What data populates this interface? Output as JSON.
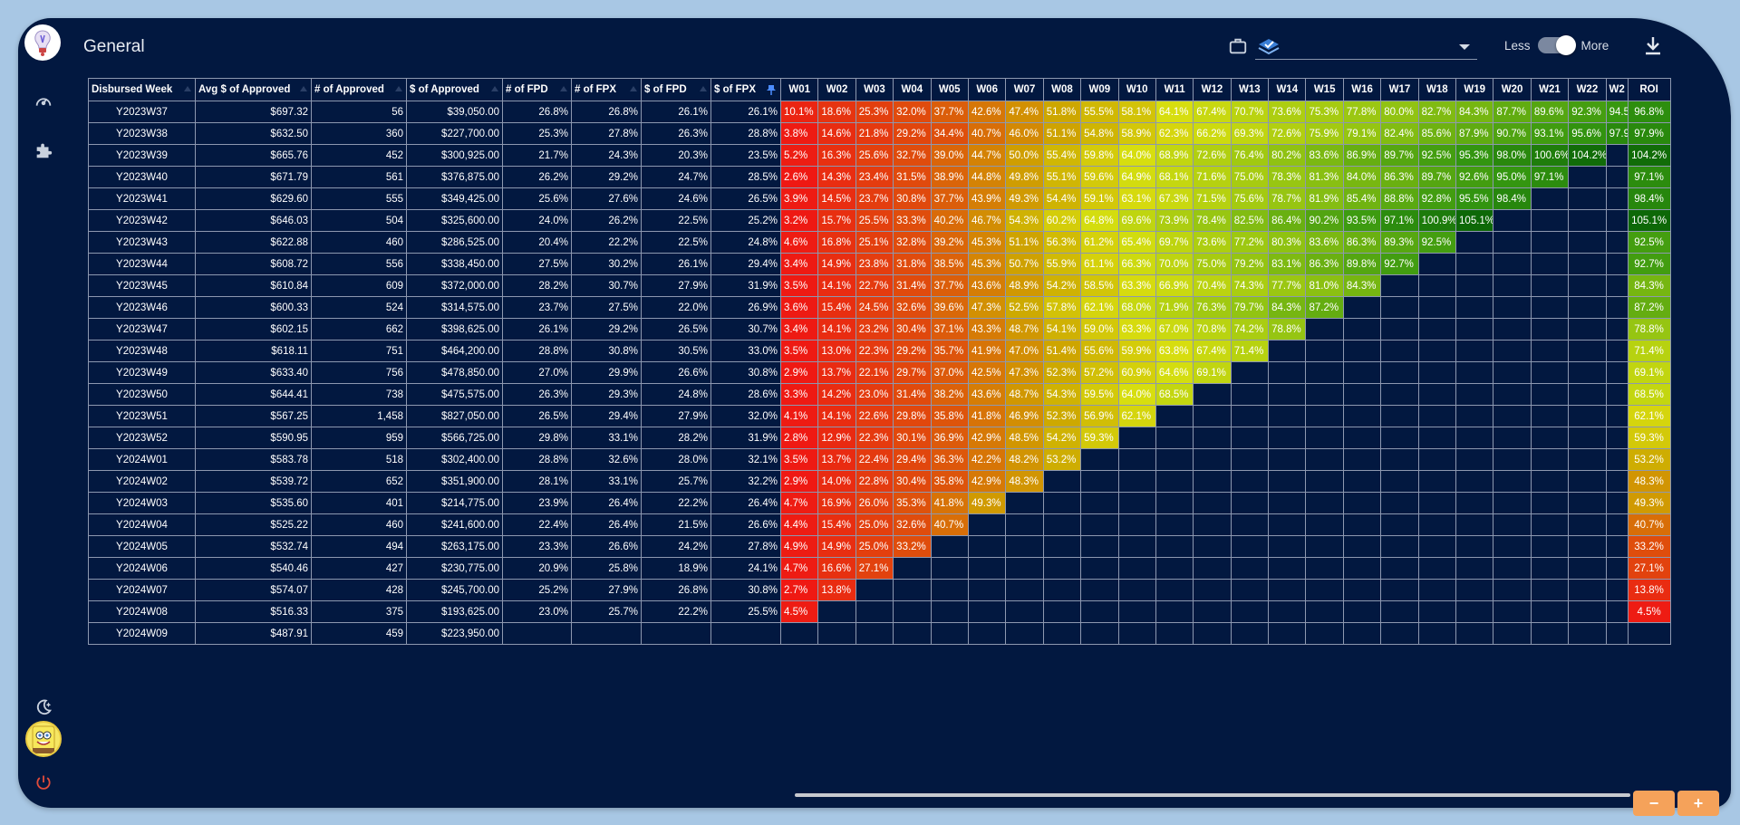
{
  "app": {
    "title": "General",
    "toggle": {
      "less_label": "Less",
      "more_label": "More",
      "state": "More"
    },
    "zoom": {
      "minus_label": "−",
      "plus_label": "+"
    }
  },
  "table": {
    "headers": [
      "Disbursed Week",
      "Avg $ of Approved",
      "# of Approved",
      "$ of Approved",
      "# of FPD",
      "# of FPX",
      "$ of FPD",
      "$ of FPX"
    ],
    "week_headers": [
      "W01",
      "W02",
      "W03",
      "W04",
      "W05",
      "W06",
      "W07",
      "W08",
      "W09",
      "W10",
      "W11",
      "W12",
      "W13",
      "W14",
      "W15",
      "W16",
      "W17",
      "W18",
      "W19",
      "W20",
      "W21",
      "W22",
      "W2"
    ],
    "roi_header": "ROI",
    "rows": [
      {
        "week": "Y2023W37",
        "avg": "$697.32",
        "n": "56",
        "amt": "$39,050.00",
        "nfpd": "26.8%",
        "nfpx": "26.8%",
        "dfpd": "26.1%",
        "dfpx": "26.1%",
        "cells": [
          "10.1%",
          "18.6%",
          "25.3%",
          "32.0%",
          "37.7%",
          "42.6%",
          "47.4%",
          "51.8%",
          "55.5%",
          "58.1%",
          "64.1%",
          "67.4%",
          "70.7%",
          "73.6%",
          "75.3%",
          "77.8%",
          "80.0%",
          "82.7%",
          "84.3%",
          "87.7%",
          "89.6%",
          "92.3%",
          "94.5"
        ],
        "roi": "96.8%"
      },
      {
        "week": "Y2023W38",
        "avg": "$632.50",
        "n": "360",
        "amt": "$227,700.00",
        "nfpd": "25.3%",
        "nfpx": "27.8%",
        "dfpd": "26.3%",
        "dfpx": "28.8%",
        "cells": [
          "3.8%",
          "14.6%",
          "21.8%",
          "29.2%",
          "34.4%",
          "40.7%",
          "46.0%",
          "51.1%",
          "54.8%",
          "58.9%",
          "62.3%",
          "66.2%",
          "69.3%",
          "72.6%",
          "75.9%",
          "79.1%",
          "82.4%",
          "85.6%",
          "87.9%",
          "90.7%",
          "93.1%",
          "95.6%",
          "97.9"
        ],
        "roi": "97.9%"
      },
      {
        "week": "Y2023W39",
        "avg": "$665.76",
        "n": "452",
        "amt": "$300,925.00",
        "nfpd": "21.7%",
        "nfpx": "24.3%",
        "dfpd": "20.3%",
        "dfpx": "23.5%",
        "cells": [
          "5.2%",
          "16.3%",
          "25.6%",
          "32.7%",
          "39.0%",
          "44.7%",
          "50.0%",
          "55.4%",
          "59.8%",
          "64.0%",
          "68.9%",
          "72.6%",
          "76.4%",
          "80.2%",
          "83.6%",
          "86.9%",
          "89.7%",
          "92.5%",
          "95.3%",
          "98.0%",
          "100.6%",
          "104.2%"
        ],
        "roi": "104.2%"
      },
      {
        "week": "Y2023W40",
        "avg": "$671.79",
        "n": "561",
        "amt": "$376,875.00",
        "nfpd": "26.2%",
        "nfpx": "29.2%",
        "dfpd": "24.7%",
        "dfpx": "28.5%",
        "cells": [
          "2.6%",
          "14.3%",
          "23.4%",
          "31.5%",
          "38.9%",
          "44.8%",
          "49.8%",
          "55.1%",
          "59.6%",
          "64.9%",
          "68.1%",
          "71.6%",
          "75.0%",
          "78.3%",
          "81.3%",
          "84.0%",
          "86.3%",
          "89.7%",
          "92.6%",
          "95.0%",
          "97.1%"
        ],
        "roi": "97.1%"
      },
      {
        "week": "Y2023W41",
        "avg": "$629.60",
        "n": "555",
        "amt": "$349,425.00",
        "nfpd": "25.6%",
        "nfpx": "27.6%",
        "dfpd": "24.6%",
        "dfpx": "26.5%",
        "cells": [
          "3.9%",
          "14.5%",
          "23.7%",
          "30.8%",
          "37.7%",
          "43.9%",
          "49.3%",
          "54.4%",
          "59.1%",
          "63.1%",
          "67.3%",
          "71.5%",
          "75.6%",
          "78.7%",
          "81.9%",
          "85.4%",
          "88.8%",
          "92.8%",
          "95.5%",
          "98.4%"
        ],
        "roi": "98.4%"
      },
      {
        "week": "Y2023W42",
        "avg": "$646.03",
        "n": "504",
        "amt": "$325,600.00",
        "nfpd": "24.0%",
        "nfpx": "26.2%",
        "dfpd": "22.5%",
        "dfpx": "25.2%",
        "cells": [
          "3.2%",
          "15.7%",
          "25.5%",
          "33.3%",
          "40.2%",
          "46.7%",
          "54.3%",
          "60.2%",
          "64.8%",
          "69.6%",
          "73.9%",
          "78.4%",
          "82.5%",
          "86.4%",
          "90.2%",
          "93.5%",
          "97.1%",
          "100.9%",
          "105.1%"
        ],
        "roi": "105.1%"
      },
      {
        "week": "Y2023W43",
        "avg": "$622.88",
        "n": "460",
        "amt": "$286,525.00",
        "nfpd": "20.4%",
        "nfpx": "22.2%",
        "dfpd": "22.5%",
        "dfpx": "24.8%",
        "cells": [
          "4.6%",
          "16.8%",
          "25.1%",
          "32.8%",
          "39.2%",
          "45.3%",
          "51.1%",
          "56.3%",
          "61.2%",
          "65.4%",
          "69.7%",
          "73.6%",
          "77.2%",
          "80.3%",
          "83.6%",
          "86.3%",
          "89.3%",
          "92.5%"
        ],
        "roi": "92.5%"
      },
      {
        "week": "Y2023W44",
        "avg": "$608.72",
        "n": "556",
        "amt": "$338,450.00",
        "nfpd": "27.5%",
        "nfpx": "30.2%",
        "dfpd": "26.1%",
        "dfpx": "29.4%",
        "cells": [
          "3.4%",
          "14.9%",
          "23.8%",
          "31.8%",
          "38.5%",
          "45.3%",
          "50.7%",
          "55.9%",
          "61.1%",
          "66.3%",
          "70.0%",
          "75.0%",
          "79.2%",
          "83.1%",
          "86.3%",
          "89.8%",
          "92.7%"
        ],
        "roi": "92.7%"
      },
      {
        "week": "Y2023W45",
        "avg": "$610.84",
        "n": "609",
        "amt": "$372,000.00",
        "nfpd": "28.2%",
        "nfpx": "30.7%",
        "dfpd": "27.9%",
        "dfpx": "31.9%",
        "cells": [
          "3.5%",
          "14.1%",
          "22.7%",
          "31.4%",
          "37.7%",
          "43.6%",
          "48.9%",
          "54.2%",
          "58.5%",
          "63.3%",
          "66.9%",
          "70.4%",
          "74.3%",
          "77.7%",
          "81.0%",
          "84.3%"
        ],
        "roi": "84.3%"
      },
      {
        "week": "Y2023W46",
        "avg": "$600.33",
        "n": "524",
        "amt": "$314,575.00",
        "nfpd": "23.7%",
        "nfpx": "27.5%",
        "dfpd": "22.0%",
        "dfpx": "26.9%",
        "cells": [
          "3.6%",
          "15.4%",
          "24.5%",
          "32.6%",
          "39.6%",
          "47.3%",
          "52.5%",
          "57.8%",
          "62.1%",
          "68.0%",
          "71.9%",
          "76.3%",
          "79.7%",
          "84.3%",
          "87.2%"
        ],
        "roi": "87.2%"
      },
      {
        "week": "Y2023W47",
        "avg": "$602.15",
        "n": "662",
        "amt": "$398,625.00",
        "nfpd": "26.1%",
        "nfpx": "29.2%",
        "dfpd": "26.5%",
        "dfpx": "30.7%",
        "cells": [
          "3.4%",
          "14.1%",
          "23.2%",
          "30.4%",
          "37.1%",
          "43.3%",
          "48.7%",
          "54.1%",
          "59.0%",
          "63.3%",
          "67.0%",
          "70.8%",
          "74.2%",
          "78.8%"
        ],
        "roi": "78.8%"
      },
      {
        "week": "Y2023W48",
        "avg": "$618.11",
        "n": "751",
        "amt": "$464,200.00",
        "nfpd": "28.8%",
        "nfpx": "30.8%",
        "dfpd": "30.5%",
        "dfpx": "33.0%",
        "cells": [
          "3.5%",
          "13.0%",
          "22.3%",
          "29.2%",
          "35.7%",
          "41.9%",
          "47.0%",
          "51.4%",
          "55.6%",
          "59.9%",
          "63.8%",
          "67.4%",
          "71.4%"
        ],
        "roi": "71.4%"
      },
      {
        "week": "Y2023W49",
        "avg": "$633.40",
        "n": "756",
        "amt": "$478,850.00",
        "nfpd": "27.0%",
        "nfpx": "29.9%",
        "dfpd": "26.6%",
        "dfpx": "30.8%",
        "cells": [
          "2.9%",
          "13.7%",
          "22.1%",
          "29.7%",
          "37.0%",
          "42.5%",
          "47.3%",
          "52.3%",
          "57.2%",
          "60.9%",
          "64.6%",
          "69.1%"
        ],
        "roi": "69.1%"
      },
      {
        "week": "Y2023W50",
        "avg": "$644.41",
        "n": "738",
        "amt": "$475,575.00",
        "nfpd": "26.3%",
        "nfpx": "29.3%",
        "dfpd": "24.8%",
        "dfpx": "28.6%",
        "cells": [
          "3.3%",
          "14.2%",
          "23.0%",
          "31.4%",
          "38.2%",
          "43.6%",
          "48.7%",
          "54.3%",
          "59.5%",
          "64.0%",
          "68.5%"
        ],
        "roi": "68.5%"
      },
      {
        "week": "Y2023W51",
        "avg": "$567.25",
        "n": "1,458",
        "amt": "$827,050.00",
        "nfpd": "26.5%",
        "nfpx": "29.4%",
        "dfpd": "27.9%",
        "dfpx": "32.0%",
        "cells": [
          "4.1%",
          "14.1%",
          "22.6%",
          "29.8%",
          "35.8%",
          "41.8%",
          "46.9%",
          "52.3%",
          "56.9%",
          "62.1%"
        ],
        "roi": "62.1%"
      },
      {
        "week": "Y2023W52",
        "avg": "$590.95",
        "n": "959",
        "amt": "$566,725.00",
        "nfpd": "29.8%",
        "nfpx": "33.1%",
        "dfpd": "28.2%",
        "dfpx": "31.9%",
        "cells": [
          "2.8%",
          "12.9%",
          "22.3%",
          "30.1%",
          "36.9%",
          "42.9%",
          "48.5%",
          "54.2%",
          "59.3%"
        ],
        "roi": "59.3%"
      },
      {
        "week": "Y2024W01",
        "avg": "$583.78",
        "n": "518",
        "amt": "$302,400.00",
        "nfpd": "28.8%",
        "nfpx": "32.6%",
        "dfpd": "28.0%",
        "dfpx": "32.1%",
        "cells": [
          "3.5%",
          "13.7%",
          "22.4%",
          "29.4%",
          "36.3%",
          "42.2%",
          "48.2%",
          "53.2%"
        ],
        "roi": "53.2%"
      },
      {
        "week": "Y2024W02",
        "avg": "$539.72",
        "n": "652",
        "amt": "$351,900.00",
        "nfpd": "28.1%",
        "nfpx": "33.1%",
        "dfpd": "25.7%",
        "dfpx": "32.2%",
        "cells": [
          "2.9%",
          "14.0%",
          "22.8%",
          "30.4%",
          "35.8%",
          "42.9%",
          "48.3%"
        ],
        "roi": "48.3%"
      },
      {
        "week": "Y2024W03",
        "avg": "$535.60",
        "n": "401",
        "amt": "$214,775.00",
        "nfpd": "23.9%",
        "nfpx": "26.4%",
        "dfpd": "22.2%",
        "dfpx": "26.4%",
        "cells": [
          "4.7%",
          "16.9%",
          "26.0%",
          "35.3%",
          "41.8%",
          "49.3%"
        ],
        "roi": "49.3%"
      },
      {
        "week": "Y2024W04",
        "avg": "$525.22",
        "n": "460",
        "amt": "$241,600.00",
        "nfpd": "22.4%",
        "nfpx": "26.4%",
        "dfpd": "21.5%",
        "dfpx": "26.6%",
        "cells": [
          "4.4%",
          "15.4%",
          "25.0%",
          "32.6%",
          "40.7%"
        ],
        "roi": "40.7%"
      },
      {
        "week": "Y2024W05",
        "avg": "$532.74",
        "n": "494",
        "amt": "$263,175.00",
        "nfpd": "23.3%",
        "nfpx": "26.6%",
        "dfpd": "24.2%",
        "dfpx": "27.8%",
        "cells": [
          "4.9%",
          "14.9%",
          "25.0%",
          "33.2%"
        ],
        "roi": "33.2%"
      },
      {
        "week": "Y2024W06",
        "avg": "$540.46",
        "n": "427",
        "amt": "$230,775.00",
        "nfpd": "20.9%",
        "nfpx": "25.8%",
        "dfpd": "18.9%",
        "dfpx": "24.1%",
        "cells": [
          "4.7%",
          "16.6%",
          "27.1%"
        ],
        "roi": "27.1%"
      },
      {
        "week": "Y2024W07",
        "avg": "$574.07",
        "n": "428",
        "amt": "$245,700.00",
        "nfpd": "25.2%",
        "nfpx": "27.9%",
        "dfpd": "26.8%",
        "dfpx": "30.8%",
        "cells": [
          "2.7%",
          "13.8%"
        ],
        "roi": "13.8%"
      },
      {
        "week": "Y2024W08",
        "avg": "$516.33",
        "n": "375",
        "amt": "$193,625.00",
        "nfpd": "23.0%",
        "nfpx": "25.7%",
        "dfpd": "22.2%",
        "dfpx": "25.5%",
        "cells": [
          "4.5%"
        ],
        "roi": "4.5%"
      },
      {
        "week": "Y2024W09",
        "avg": "$487.91",
        "n": "459",
        "amt": "$223,950.00",
        "nfpd": "",
        "nfpx": "",
        "dfpd": "",
        "dfpx": "",
        "cells": [],
        "roi": ""
      }
    ]
  }
}
